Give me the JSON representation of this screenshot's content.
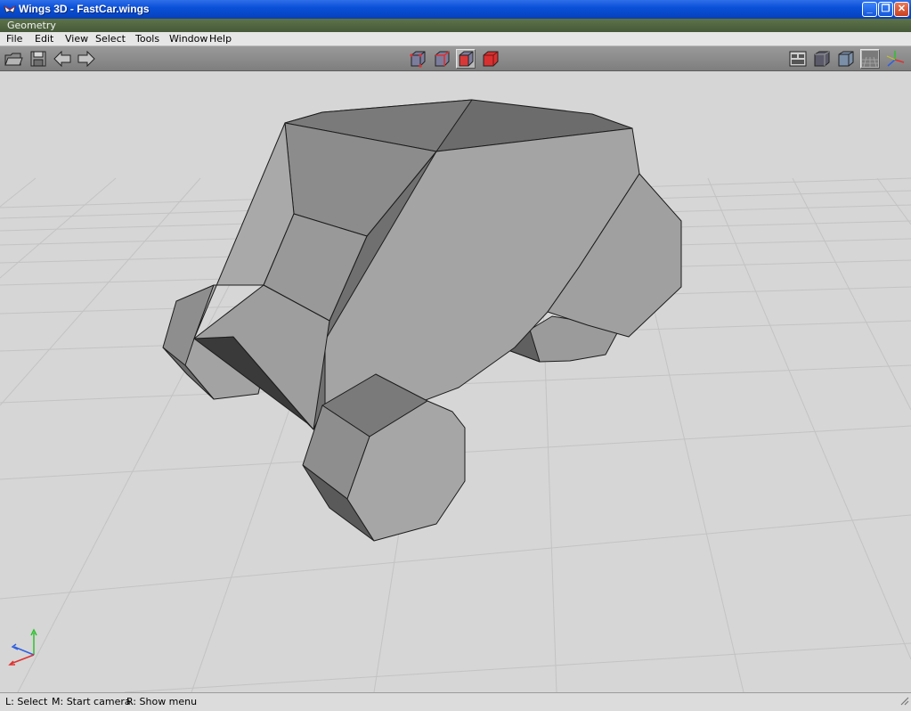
{
  "window": {
    "title": "Wings 3D - FastCar.wings",
    "minimize_label": "_",
    "maximize_label": "❐",
    "close_label": "✕"
  },
  "geometry_bar": {
    "label": "Geometry"
  },
  "menubar": {
    "items": [
      {
        "label": "File"
      },
      {
        "label": "Edit"
      },
      {
        "label": "View"
      },
      {
        "label": "Select"
      },
      {
        "label": "Tools"
      },
      {
        "label": "Window"
      },
      {
        "label": "Help"
      }
    ]
  },
  "toolbar": {
    "left_icons": [
      "open-folder-icon",
      "save-icon",
      "undo-arrow-icon",
      "redo-arrow-icon"
    ],
    "selection_modes": [
      "vertex-mode-icon",
      "edge-mode-icon",
      "face-mode-icon",
      "object-mode-icon"
    ],
    "active_selection_mode": "face",
    "right_icons": [
      "workspace-icon",
      "smooth-shading-icon",
      "flat-shading-icon",
      "ground-plane-icon",
      "axes-icon"
    ]
  },
  "viewport": {
    "model": "FastCar",
    "background_color": "#d6d6d6",
    "grid_color": "#c2c2c2",
    "face_color": "#9a9a9a",
    "axes": {
      "x_color": "#e03030",
      "y_color": "#30c030",
      "z_color": "#3060e0"
    }
  },
  "statusbar": {
    "hint_left": "L: Select",
    "hint_middle": "M: Start camera",
    "hint_right": "R: Show menu"
  }
}
